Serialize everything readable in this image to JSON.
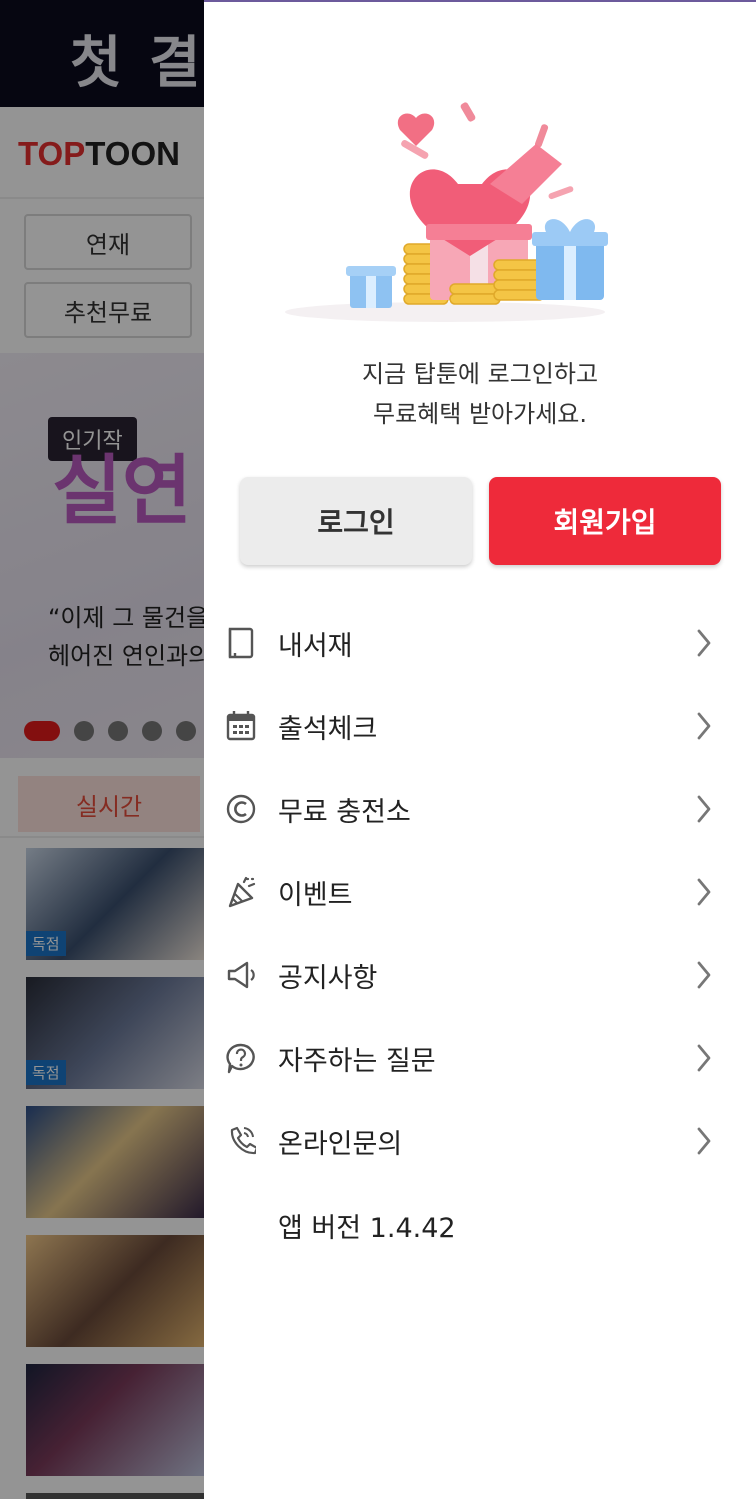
{
  "background_app": {
    "banner_text": "첫 결",
    "logo_top": "TOP",
    "logo_toon": "TOON",
    "genre_buttons": [
      "연재",
      "추천무료"
    ],
    "hero": {
      "badge": "인기작",
      "title": "실연",
      "subtitle_lines": [
        "“이제 그 물건을",
        "헤어진 연인과의"
      ]
    },
    "carousel": {
      "count": 6,
      "active_index": 0
    },
    "tab_realtime": "실시간",
    "thumb_badge": "독점"
  },
  "drawer": {
    "login_message_lines": [
      "지금 탑툰에 로그인하고",
      "무료혜택 받아가세요."
    ],
    "login_button": "로그인",
    "signup_button": "회원가입",
    "menu_items": [
      {
        "label": "내서재",
        "icon": "book-icon"
      },
      {
        "label": "출석체크",
        "icon": "calendar-icon"
      },
      {
        "label": "무료 충전소",
        "icon": "copyright-coin-icon"
      },
      {
        "label": "이벤트",
        "icon": "party-popper-icon"
      },
      {
        "label": "공지사항",
        "icon": "megaphone-icon"
      },
      {
        "label": "자주하는 질문",
        "icon": "question-bubble-icon"
      },
      {
        "label": "온라인문의",
        "icon": "phone-call-icon"
      }
    ],
    "app_version": "앱 버전 1.4.42"
  },
  "colors": {
    "accent_red": "#ee2a3a",
    "login_gray": "#ececec",
    "brand_red": "#e52f2f"
  }
}
